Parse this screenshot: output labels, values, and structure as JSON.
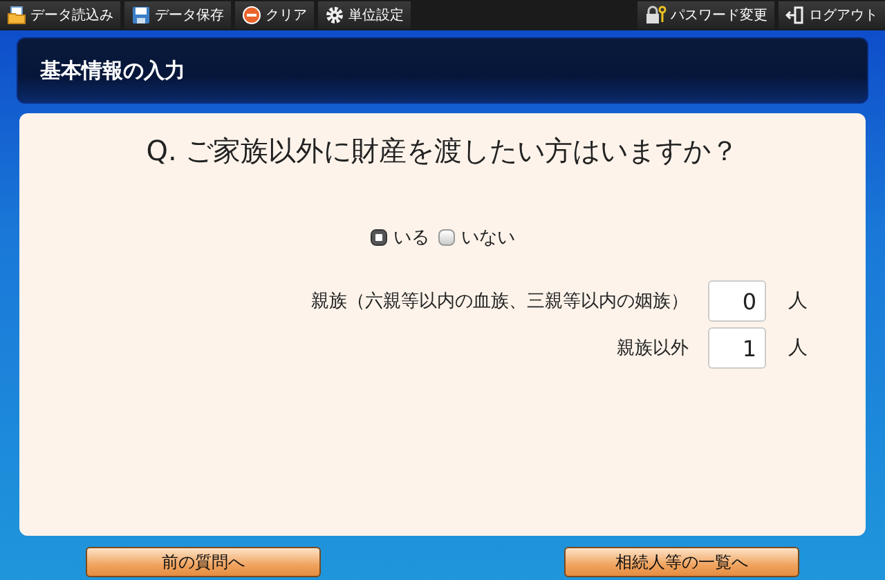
{
  "toolbar": {
    "left": [
      {
        "kind": "load",
        "label": "データ読込み"
      },
      {
        "kind": "save",
        "label": "データ保存"
      },
      {
        "kind": "clear",
        "label": "クリア"
      },
      {
        "kind": "settings",
        "label": "単位設定"
      }
    ],
    "right": [
      {
        "kind": "password",
        "label": "パスワード変更"
      },
      {
        "kind": "logout",
        "label": "ログアウト"
      }
    ]
  },
  "header": {
    "title": "基本情報の入力"
  },
  "question": "Q. ご家族以外に財産を渡したい方はいますか？",
  "options": [
    {
      "label": "いる",
      "selected": true
    },
    {
      "label": "いない",
      "selected": false
    }
  ],
  "counts": [
    {
      "label": "親族（六親等以内の血族、三親等以内の姻族）",
      "value": "0",
      "unit": "人"
    },
    {
      "label": "親族以外",
      "value": "1",
      "unit": "人"
    }
  ],
  "buttons": {
    "back": "前の質問へ",
    "next": "相続人等の一覧へ"
  }
}
